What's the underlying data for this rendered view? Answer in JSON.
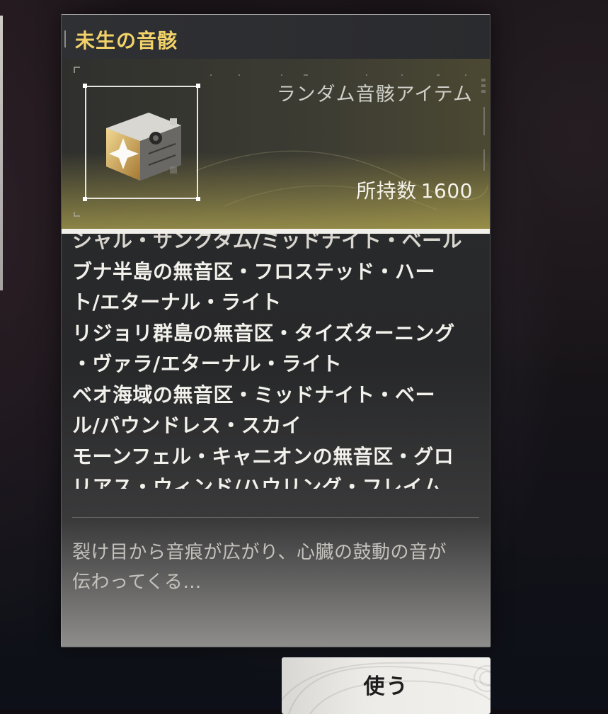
{
  "item": {
    "name": "未生の音骸",
    "type": "ランダム音骸アイテム",
    "count_label": "所持数",
    "count": "1600",
    "icon": "silver-gold-supply-box-icon"
  },
  "description": {
    "lines": [
      "シャル・サンクタム/ミッドナイト・ベール",
      "ブナ半島の無音区・フロステッド・ハー",
      "ト/エターナル・ライト",
      "リジョリ群島の無音区・タイズターニング",
      "・ヴァラ/エターナル・ライト",
      "ベオ海域の無音区・ミッドナイト・ベー",
      "ル/バウンドレス・スカイ",
      "モーンフェル・キャニオンの無音区・グロ",
      "リアス・ウィンド/ハウリング・フレイム"
    ]
  },
  "flavor": {
    "lines": [
      "裂け目から音痕が広がり、心臓の鼓動の音が",
      "伝わってくる…"
    ]
  },
  "actions": {
    "use_label": "使う"
  },
  "colors": {
    "title": "#f2d36a",
    "hero_glow": "#d7c85a",
    "button_bg": "#ecebe8"
  }
}
